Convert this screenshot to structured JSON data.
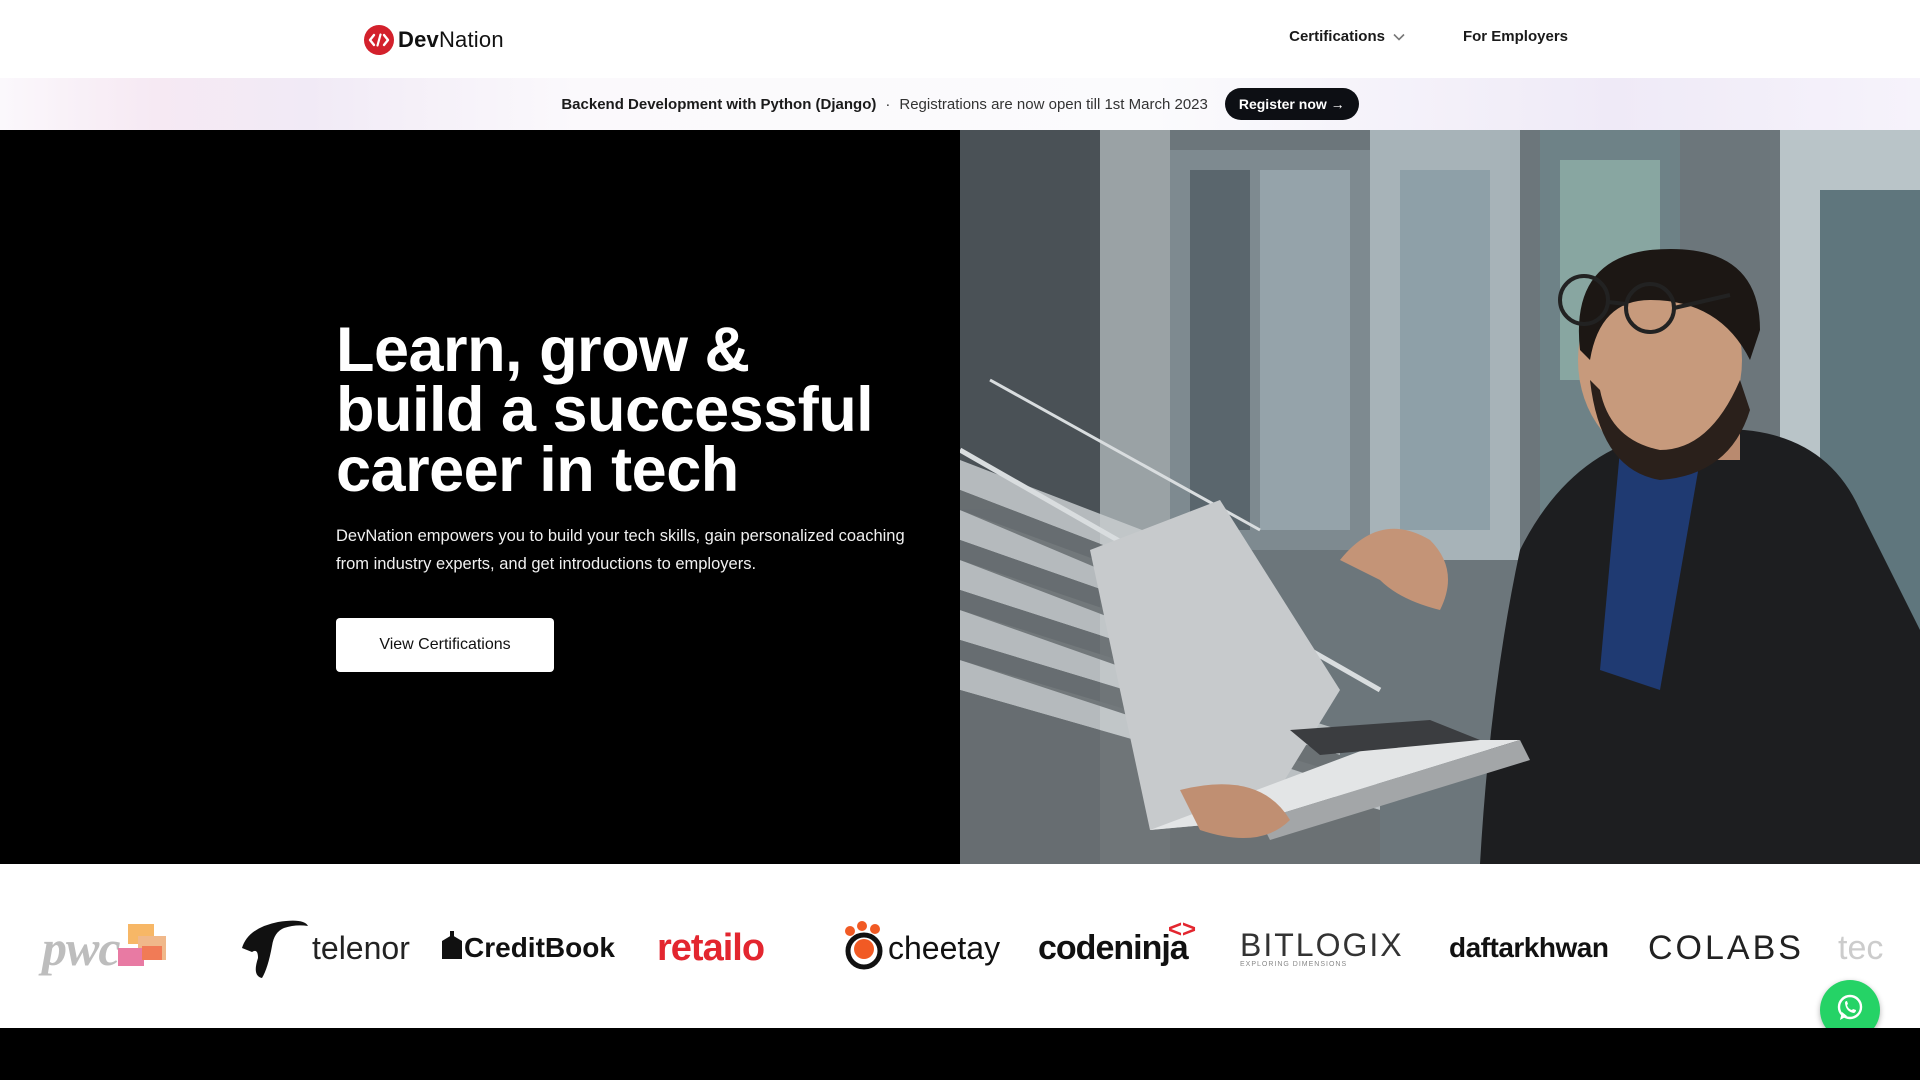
{
  "brand": {
    "name_part1": "Dev",
    "name_part2": "Nation",
    "accent_color": "#d3212c",
    "icon": "code-brackets-icon"
  },
  "nav": {
    "links": [
      {
        "label": "Certifications",
        "icon": "chevron-down-icon"
      },
      {
        "label": "For Employers"
      }
    ]
  },
  "announcement": {
    "title": "Backend Development with Python (Django)",
    "separator": "·",
    "text": "Registrations are now open till 1st March 2023",
    "button_label": "Register now →"
  },
  "hero": {
    "title_line1": "Learn, grow &",
    "title_line2": "build a successful",
    "title_line3": "career in tech",
    "description": "DevNation empowers you to build your tech skills, gain personalized coaching from industry experts, and get introductions to employers.",
    "cta_label": "View Certifications",
    "image": "man-with-laptop-photo"
  },
  "partners": [
    {
      "name": "pwc"
    },
    {
      "name": "telenor"
    },
    {
      "name": "CreditBook"
    },
    {
      "name": "retailo"
    },
    {
      "name": "cheetay"
    },
    {
      "name": "codeninja"
    },
    {
      "name": "BITLOGIX",
      "tagline": "EXPLORING DIMENSIONS"
    },
    {
      "name": "daftarkhwan"
    },
    {
      "name": "COLABS"
    },
    {
      "name": "tec"
    }
  ],
  "floating": {
    "icon": "whatsapp-icon",
    "color": "#25d366"
  }
}
